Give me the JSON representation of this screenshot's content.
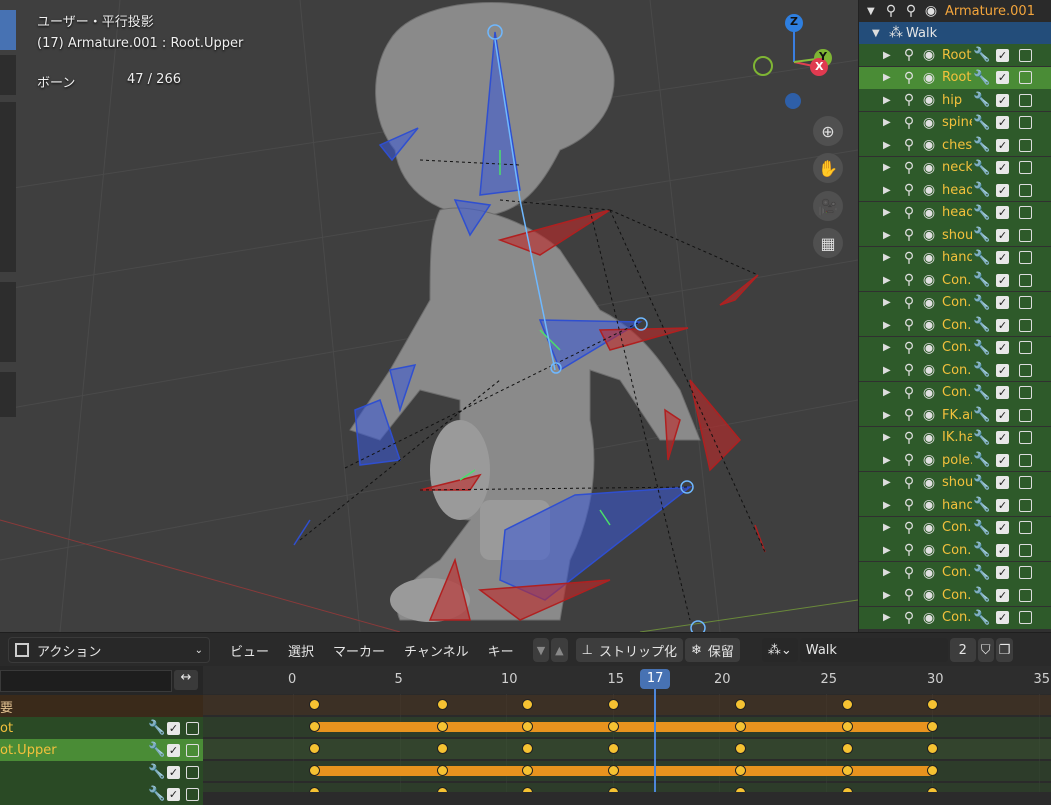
{
  "viewport": {
    "view_mode": "ユーザー・平行投影",
    "active_object": "(17) Armature.001 : Root.Upper",
    "bones_label": "ボーン",
    "bones_count": "47 / 266",
    "gizmo": {
      "z": "Z",
      "y": "Y",
      "x": "X"
    },
    "nav_icons": [
      "zoom-in-icon",
      "hand-pan-icon",
      "camera-icon",
      "grid-icon"
    ]
  },
  "outliner": {
    "armature_name": "Armature.001",
    "action_name": "Walk",
    "bones": [
      "Root",
      "Root",
      "hip",
      "spine",
      "ches",
      "neck",
      "head",
      "head",
      "shou",
      "hand",
      "Con.",
      "Con.",
      "Con.",
      "Con.",
      "Con.",
      "Con.",
      "FK.ar",
      "IK.ha",
      "pole.",
      "shou",
      "hand",
      "Con.",
      "Con.",
      "Con.",
      "Con.",
      "Con."
    ]
  },
  "dope_header": {
    "mode": "アクション",
    "menus": [
      "ビュー",
      "選択",
      "マーカー",
      "チャンネル",
      "キー"
    ],
    "stash_label": "ストリップ化",
    "hold_label": "保留",
    "action_name": "Walk",
    "users": "2"
  },
  "dope_sheet": {
    "frame_ticks": [
      "0",
      "5",
      "10",
      "15",
      "20",
      "25",
      "30",
      "35"
    ],
    "current_frame": "17",
    "channels": [
      "要",
      "ot",
      "ot.Upper",
      "",
      ""
    ],
    "key_frames": [
      1,
      7,
      11,
      15,
      21,
      26,
      30
    ]
  },
  "colors": {
    "accent_blue": "#4772b3",
    "bone_name": "#f3c13c",
    "key": "#f5c232",
    "hold": "#e8931e"
  }
}
